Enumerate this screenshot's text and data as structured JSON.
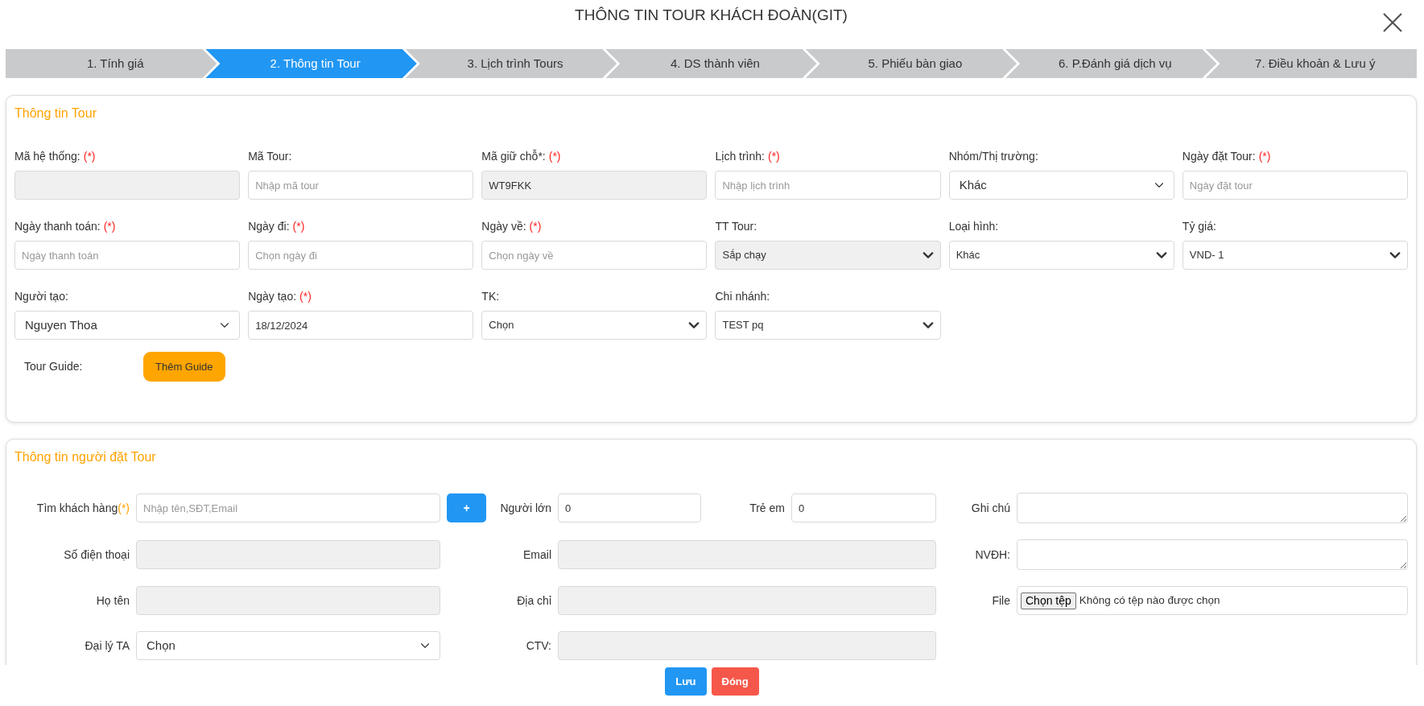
{
  "window": {
    "title": "THÔNG TIN TOUR KHÁCH ĐOÀN(GIT)"
  },
  "steps": [
    {
      "label": "1. Tính giá",
      "selected": false
    },
    {
      "label": "2. Thông tin Tour",
      "selected": true
    },
    {
      "label": "3. Lịch trình Tours",
      "selected": false
    },
    {
      "label": "4. DS thành viên",
      "selected": false
    },
    {
      "label": "5. Phiếu bàn giao",
      "selected": false
    },
    {
      "label": "6. P.Đánh giá dịch vụ",
      "selected": false
    },
    {
      "label": "7. Điều khoản & Lưu ý",
      "selected": false
    }
  ],
  "tour_section": {
    "title": "Thông tin Tour",
    "fields": [
      {
        "label": "Mã hệ thống:",
        "required_mark": "(*)",
        "kind": "input",
        "readonly": true
      },
      {
        "label": "Mã Tour:",
        "kind": "input",
        "placeholder": "Nhập mã tour",
        "readonly": false
      },
      {
        "label": "Mã giữ chỗ*:",
        "required_mark": "(*)",
        "kind": "input",
        "value": "WT9FKK",
        "readonly": true
      },
      {
        "label": "Lịch trình:",
        "required_mark": "(*)",
        "kind": "input",
        "placeholder": "Nhập lịch trình",
        "readonly": false
      },
      {
        "label": "Nhóm/Thị trường:",
        "kind": "select-custom",
        "value": "Khác",
        "readonly": false
      },
      {
        "label": "Ngày đặt Tour:",
        "required_mark": "(*)",
        "kind": "input",
        "placeholder": "Ngày đặt tour",
        "readonly": false
      },
      {
        "label": "Ngày thanh toán:",
        "required_mark": "(*)",
        "kind": "input",
        "placeholder": "Ngày thanh toán",
        "readonly": false
      },
      {
        "label": "Ngày đi:",
        "required_mark": "(*)",
        "kind": "input",
        "placeholder": "Chọn ngày đi",
        "readonly": false
      },
      {
        "label": "Ngày về:",
        "required_mark": "(*)",
        "kind": "input",
        "placeholder": "Chọn ngày về",
        "readonly": false
      },
      {
        "label": "TT Tour:",
        "kind": "select",
        "value": "Sắp chạy",
        "readonly": true
      },
      {
        "label": "Loại hình:",
        "kind": "select",
        "value": "Khác",
        "readonly": false
      },
      {
        "label": "Tỷ giá:",
        "kind": "select",
        "value": "VND- 1",
        "readonly": false
      },
      {
        "label": "Người tạo:",
        "kind": "select-custom",
        "value": "Nguyen Thoa",
        "readonly": false
      },
      {
        "label": "Ngày tạo:",
        "required_mark": "(*)",
        "kind": "input",
        "value": "18/12/2024",
        "readonly": false
      },
      {
        "label": "TK:",
        "kind": "select",
        "value": "Chọn",
        "readonly": false
      },
      {
        "label": "Chi nhánh:",
        "kind": "select",
        "value": "TEST pq",
        "readonly": false
      }
    ],
    "guide": {
      "label": "Tour Guide:",
      "button": "Thêm Guide"
    }
  },
  "customer_section": {
    "title": "Thông tin người đặt Tour",
    "rows": [
      {
        "left": {
          "label": "Tìm khách hàng",
          "required_mark": "(*)",
          "kind": "input",
          "placeholder": "Nhập tên,SĐT,Email",
          "readonly": false
        },
        "add_button": "+",
        "middle": [
          {
            "label": "Người lớn",
            "kind": "input",
            "value": "0",
            "readonly": false
          },
          {
            "label": "Trẻ em",
            "kind": "input",
            "value": "0",
            "readonly": false
          }
        ],
        "right": {
          "label": "Ghi chú",
          "kind": "textarea"
        }
      },
      {
        "left": {
          "label": "Số điện thoại",
          "kind": "input",
          "readonly": true
        },
        "middle": [
          {
            "label": "Email",
            "kind": "input",
            "readonly": true
          }
        ],
        "right": {
          "label": "NVĐH:",
          "kind": "textarea"
        }
      },
      {
        "left": {
          "label": "Họ tên",
          "kind": "input",
          "readonly": true
        },
        "middle": [
          {
            "label": "Địa chỉ",
            "kind": "input",
            "readonly": true
          }
        ],
        "right": {
          "label": "File",
          "kind": "file",
          "button": "Chọn tệp",
          "status": "Không có tệp nào được chọn"
        }
      },
      {
        "left": {
          "label": "Đại lý TA",
          "kind": "select-custom",
          "value": "Chọn",
          "readonly": false
        },
        "middle": [
          {
            "label": "CTV:",
            "kind": "input",
            "readonly": true
          }
        ]
      }
    ]
  },
  "footer": {
    "buttons": [
      {
        "label": "Lưu",
        "kind": "primary"
      },
      {
        "label": "Đóng",
        "kind": "danger"
      }
    ]
  }
}
